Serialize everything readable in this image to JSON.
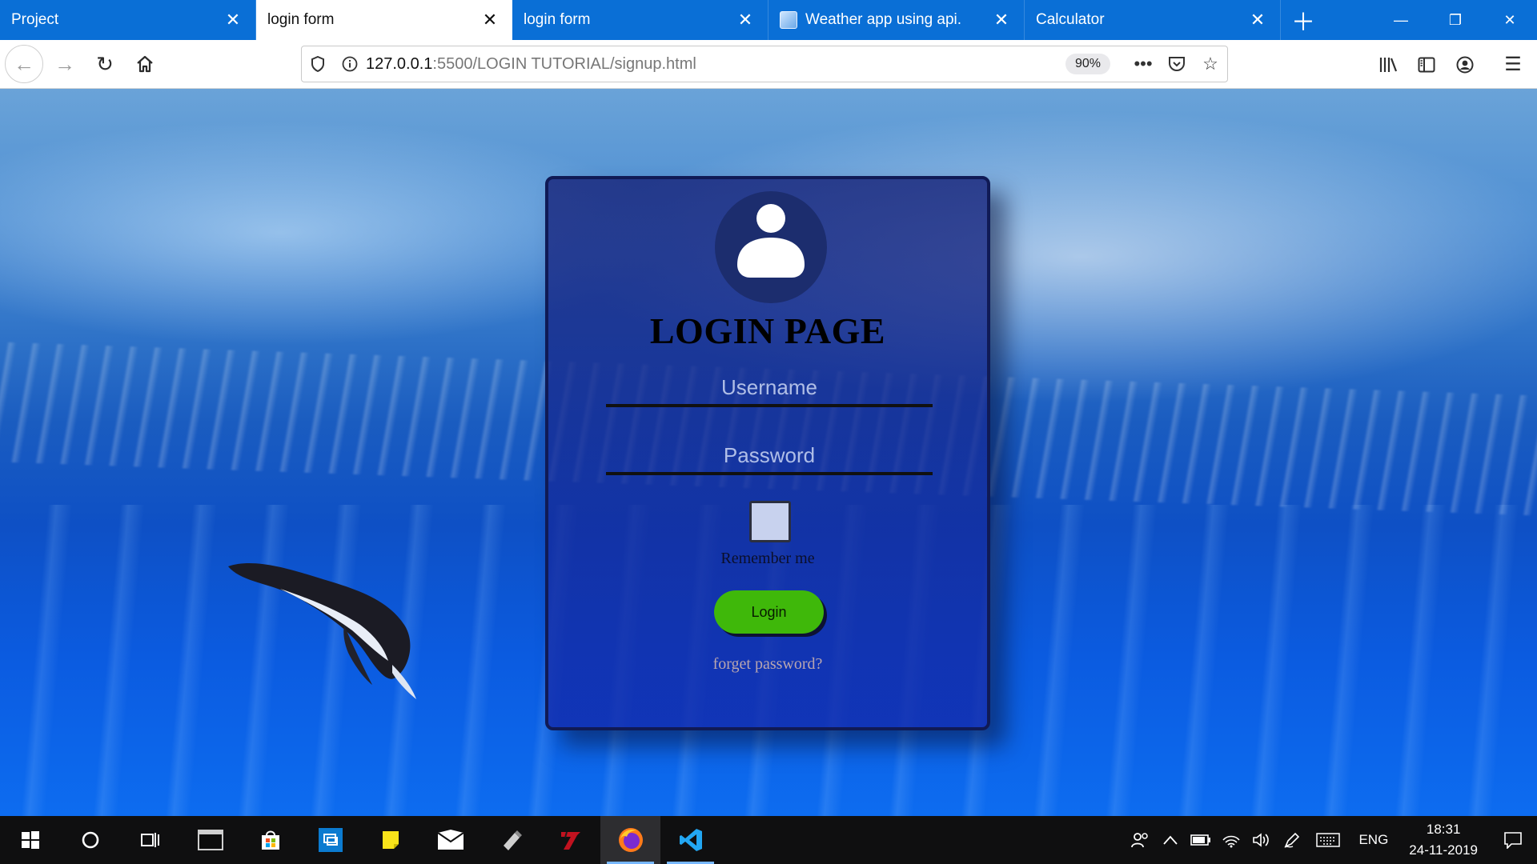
{
  "browser": {
    "tabs": [
      {
        "title": "Project",
        "active": false,
        "favicon": false
      },
      {
        "title": "login form",
        "active": true,
        "favicon": false
      },
      {
        "title": "login form",
        "active": false,
        "favicon": false
      },
      {
        "title": "Weather app using api.",
        "active": false,
        "favicon": true
      },
      {
        "title": "Calculator",
        "active": false,
        "favicon": false
      }
    ],
    "new_tab_icon": "plus-icon",
    "window_controls": [
      "minimize-icon",
      "restore-icon",
      "close-icon"
    ],
    "url": {
      "host": "127.0.0.1",
      "path": ":5500/LOGIN TUTORIAL/signup.html"
    },
    "zoom_level": "90%",
    "colors": {
      "tabstrip": "#0a6fd6",
      "active_tab": "#ffffff"
    }
  },
  "page": {
    "title": "LOGIN PAGE",
    "username_placeholder": "Username",
    "password_placeholder": "Password",
    "remember_label": "Remember me",
    "login_button": "Login",
    "forget_link": "forget password?",
    "colors": {
      "card_border": "#101a55",
      "login_button": "#3fb80a",
      "forget_link": "#b9a6b0"
    }
  },
  "taskbar": {
    "apps": [
      "windows-start-icon",
      "cortana-icon",
      "task-view-icon",
      "terminal-icon",
      "store-icon",
      "remote-desktop-icon",
      "sticky-notes-icon",
      "mail-icon",
      "usb-drive-icon",
      "media-app-icon",
      "firefox-icon",
      "vscode-icon"
    ],
    "language": "ENG",
    "time": "18:31",
    "date": "24-11-2019"
  }
}
